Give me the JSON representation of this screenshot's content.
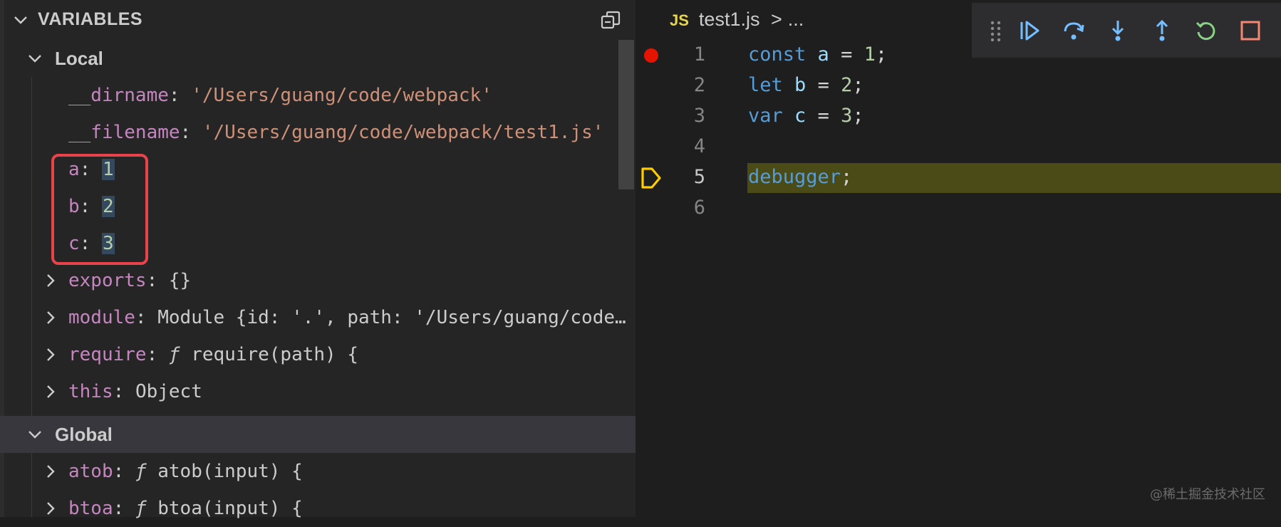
{
  "variables_panel": {
    "title": "VARIABLES",
    "collapse_icon": "collapse-all-icon",
    "local_section": {
      "title": "Local",
      "rows": [
        {
          "name": "__dirname",
          "value": "'/Users/guang/code/webpack'"
        },
        {
          "name": "__filename",
          "value": "'/Users/guang/code/webpack/test1.js'"
        },
        {
          "name": "a",
          "value": "1"
        },
        {
          "name": "b",
          "value": "2"
        },
        {
          "name": "c",
          "value": "3"
        },
        {
          "name": "exports",
          "value": "{}"
        },
        {
          "name": "module",
          "value": "Module {id: '.', path: '/Users/guang/code…"
        },
        {
          "name": "require",
          "prefix": "ƒ",
          "value": "require(path) {"
        },
        {
          "name": "this",
          "value": "Object"
        }
      ]
    },
    "global_section": {
      "title": "Global",
      "rows": [
        {
          "name": "atob",
          "prefix": "ƒ",
          "value": "atob(input) {"
        },
        {
          "name": "btoa",
          "prefix": "ƒ",
          "value": "btoa(input) {"
        }
      ]
    },
    "colors": {
      "highlight_border": "#e8434b"
    }
  },
  "editor": {
    "tab": {
      "badge": "JS",
      "filename": "test1.js",
      "breadcrumb_sep": ">",
      "breadcrumb_more": "..."
    },
    "line_numbers": [
      "1",
      "2",
      "3",
      "4",
      "5",
      "6"
    ],
    "code": {
      "l1_kw": "const",
      "l1_id": "a",
      "l1_rest1": " = ",
      "l1_num": "1",
      "l1_end": ";",
      "l2_kw": "let",
      "l2_id": "b",
      "l2_rest1": " = ",
      "l2_num": "2",
      "l2_end": ";",
      "l3_kw": "var",
      "l3_id": "c",
      "l3_rest1": " = ",
      "l3_num": "3",
      "l3_end": ";",
      "l5_kw": "debugger",
      "l5_end": ";"
    },
    "breakpoint_line": "1",
    "current_line": "5",
    "colors": {
      "breakpoint": "#e51400",
      "current_marker": "#ffcc00",
      "current_line_bg": "#4b4b18"
    }
  },
  "debug_toolbar": {
    "buttons": [
      {
        "icon": "drag-grip-icon"
      },
      {
        "icon": "continue-icon"
      },
      {
        "icon": "step-over-icon"
      },
      {
        "icon": "step-into-icon"
      },
      {
        "icon": "step-out-icon"
      },
      {
        "icon": "restart-icon"
      },
      {
        "icon": "stop-icon"
      }
    ],
    "colors": {
      "accent": "#75beff",
      "stop": "#f48771"
    }
  },
  "watermark": "@稀土掘金技术社区"
}
